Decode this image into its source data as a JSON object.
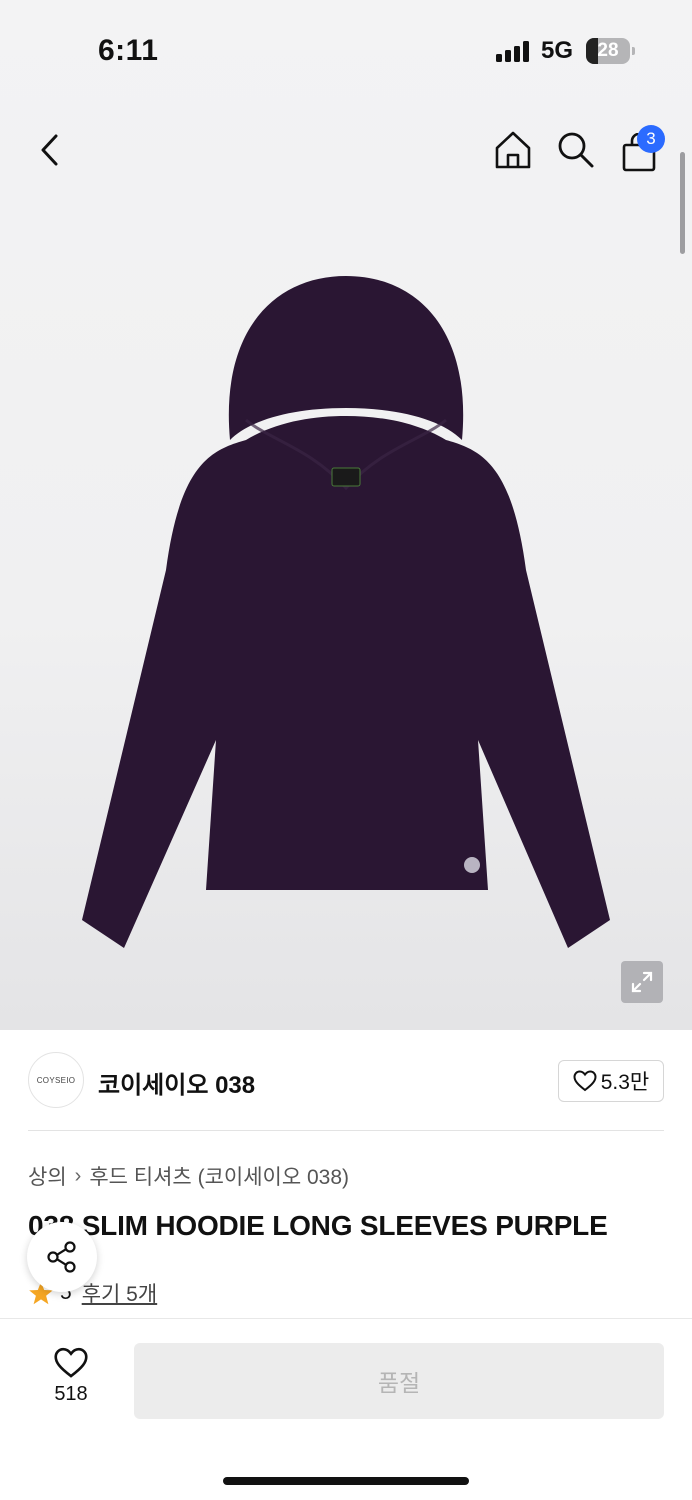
{
  "status_bar": {
    "time": "6:11",
    "network": "5G",
    "battery": "28",
    "battery_level": 0.28
  },
  "nav": {
    "cart_count": "3",
    "icons": [
      "back-icon",
      "home-icon",
      "search-icon",
      "shopping-bag-icon"
    ]
  },
  "brand": {
    "logo_text": "COYSEIO",
    "name": "코이세이오 038",
    "likes": "5.3만"
  },
  "breadcrumb": {
    "category": "상의",
    "subcategory": "후드 티셔츠 (코이세이오 038)"
  },
  "product": {
    "title": "038 SLIM HOODIE LONG SLEEVES PURPLE",
    "rating": "5",
    "reviews_label": "후기 5개",
    "garment_color": "#2a1633"
  },
  "bottom_bar": {
    "wish_count": "518",
    "buy_label": "품절"
  },
  "colors": {
    "badge": "#2b6bff",
    "star": "#f5a623"
  }
}
